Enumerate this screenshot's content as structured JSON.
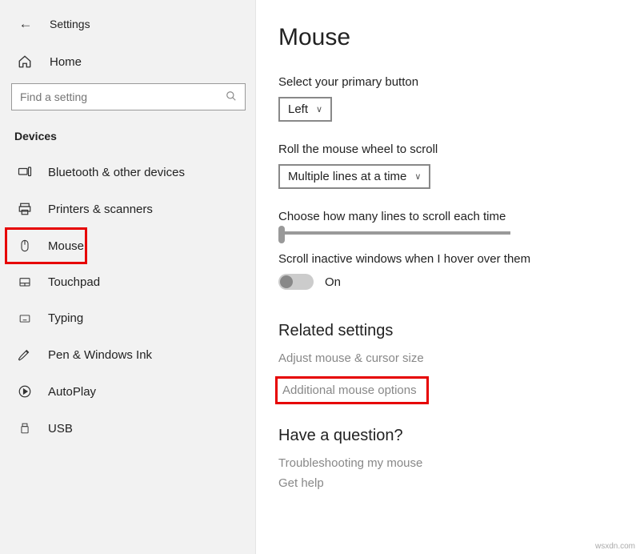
{
  "header": {
    "title": "Settings"
  },
  "home": {
    "label": "Home"
  },
  "search": {
    "placeholder": "Find a setting"
  },
  "section_label": "Devices",
  "nav": [
    {
      "label": "Bluetooth & other devices"
    },
    {
      "label": "Printers & scanners"
    },
    {
      "label": "Mouse"
    },
    {
      "label": "Touchpad"
    },
    {
      "label": "Typing"
    },
    {
      "label": "Pen & Windows Ink"
    },
    {
      "label": "AutoPlay"
    },
    {
      "label": "USB"
    }
  ],
  "main": {
    "title": "Mouse",
    "primary_button_label": "Select your primary button",
    "primary_button_value": "Left",
    "roll_label": "Roll the mouse wheel to scroll",
    "roll_value": "Multiple lines at a time",
    "lines_label": "Choose how many lines to scroll each time",
    "hover_label": "Scroll inactive windows when I hover over them",
    "hover_toggle_text": "On"
  },
  "related": {
    "heading": "Related settings",
    "link1": "Adjust mouse & cursor size",
    "link2": "Additional mouse options"
  },
  "question": {
    "heading": "Have a question?",
    "link1": "Troubleshooting my mouse",
    "link2": "Get help"
  },
  "watermark": "wsxdn.com"
}
